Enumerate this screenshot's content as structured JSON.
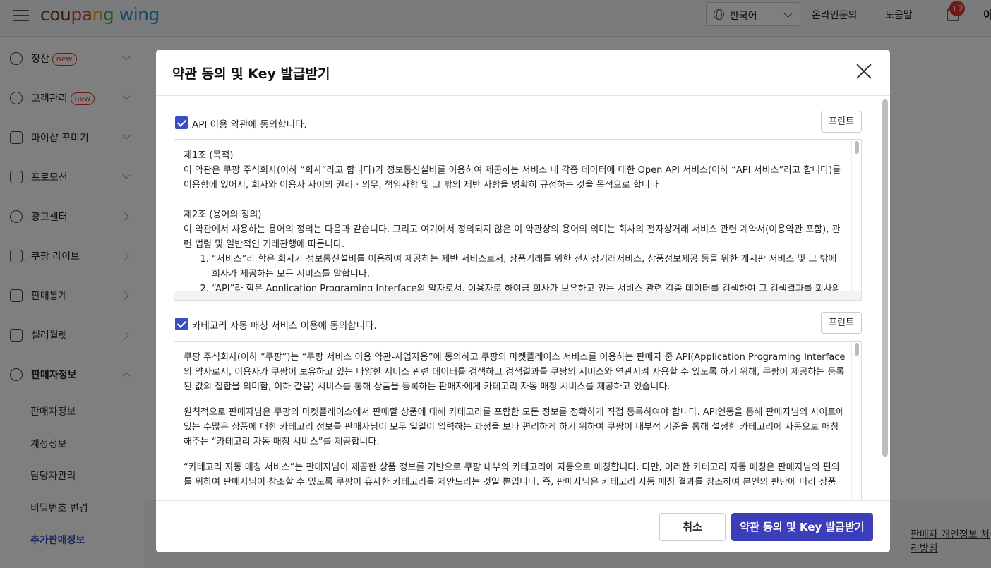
{
  "topbar": {
    "logo": {
      "c1": "cou",
      "c2": "pa",
      "c3": "n",
      "c4": "g",
      "c5": " wing"
    },
    "language": "한국어",
    "inquiry": "온라인문의",
    "help": "도움말",
    "notifications": "+9",
    "user_initial": "이"
  },
  "sidebar": {
    "items": [
      {
        "label": "정산",
        "badge": "new"
      },
      {
        "label": "고객관리",
        "badge": "new"
      },
      {
        "label": "마이샵 꾸미기"
      },
      {
        "label": "프로모션"
      },
      {
        "label": "광고센터"
      },
      {
        "label": "쿠팡 라이브"
      },
      {
        "label": "판매통계"
      },
      {
        "label": "셀러월렛"
      },
      {
        "label": "판매자정보"
      }
    ],
    "sub_items": [
      "판매자정보",
      "계정정보",
      "담당자관리",
      "비밀번호 변경",
      "추가판매정보"
    ]
  },
  "main": {
    "bottom_link": "판매자 개인정보 처리방침"
  },
  "modal": {
    "title": "약관 동의 및 Key 발급받기",
    "section1": {
      "agree_label": "API 이용 약관에 동의합니다.",
      "print_label": "프린트",
      "lines": {
        "l1": "제1조 (목적)",
        "l2": "이 약관은 쿠팡 주식회사(이하 “회사”라고 합니다)가 정보통신설비를 이용하여 제공하는 서비스 내 각종 데이터에 대한 Open API 서비스(이하 “API 서비스”라고 합니다)를 이용함에 있어서, 회사와 이용자 사이의 권리 · 의무, 책임사항 및 그 밖의 제반 사항을 명확히 규정하는 것을 목적으로 합니다",
        "l3": "제2조 (용어의 정의)",
        "l4": "이 약관에서 사용하는 용어의 정의는 다음과 같습니다. 그리고 여기에서 정의되지 않은 이 약관상의 용어의 의미는 회사의 전자상거래 서비스 관련 계약서(이용약관 포함), 관련 법령 및 일반적인 거래관행에 따릅니다.",
        "li1": "“서비스”라 함은 회사가 정보통신설비를 이용하여 제공하는 제반 서비스로서, 상품거래를 위한 전자상거래서비스, 상품정보제공 등을 위한 게시판 서비스 및 그 밖에 회사가 제공하는 모든 서비스를 말합니다.",
        "li2": "“API”라 함은 Application Programing Interface의 약자로서, 이용자로 하여금 회사가 보유하고 있는 서비스 관련 각종 데이터를 검색하여 그 검색결과를 회사의 서비스와 연관시켜 사용할 수 있도록 하기 위해 회사가 제공하는 등록된 값의 집합을 의미합니다."
      }
    },
    "section2": {
      "agree_label": "카테고리 자동 매칭 서비스 이용에 동의합니다.",
      "print_label": "프린트",
      "lines": {
        "p1": "쿠팡 주식회사(이하 “쿠팡”)는 “쿠팡 서비스 이용 약관-사업자용”에 동의하고 쿠팡의 마켓플레이스 서비스를 이용하는 판매자 중 API(Application Programing Interface의 약자로서, 이용자가 쿠팡이 보유하고 있는 다양한 서비스 관련 데이터를 검색하고 검색결과를 쿠팡의 서비스와 연관시켜 사용할 수 있도록 하기 위해, 쿠팡이 제공하는 등록된 값의 집합을 의미함, 이하 같음) 서비스를 통해 상품을 등록하는 판매자에게 카테고리 자동 매칭 서비스를 제공하고 있습니다.",
        "p2": "원칙적으로 판매자님은 쿠팡의 마켓플레이스에서 판매할 상품에 대해 카테고리를 포함한 모든 정보를 정확하게 직접 등록하여야 합니다. API연동을 통해 판매자님의 사이트에 있는 수많은 상품에 대한 카테고리 정보를 판매자님이 모두 일일이 입력하는 과정을 보다 편리하게 하기 위하여 쿠팡이 내부적 기준을 통해 설정한 카테고리에 자동으로 매칭해주는 “카테고리 자동 매칭 서비스”를 제공합니다.",
        "p3": "“카테고리 자동 매칭 서비스”는 판매자님이 제공한 상품 정보를 기반으로 쿠팡 내부의 카테고리에 자동으로 매칭합니다. 다만, 이러한 카테고리 자동 매칭은 판매자님의 편의를 위하여 판매자님이 참조할 수 있도록 쿠팡이 유사한 카테고리를 제안드리는 것일 뿐입니다. 즉, 판매자님은 카테고리 자동 매칭 결과를 참조하여 본인의 판단에 따라 상품"
      }
    },
    "cancel_label": "취소",
    "confirm_label": "약관 동의 및 Key 발급받기"
  },
  "colors": {
    "accent": "#3b3eb8",
    "checkbox": "#3b4dc2",
    "new_badge": "#e0352b"
  }
}
